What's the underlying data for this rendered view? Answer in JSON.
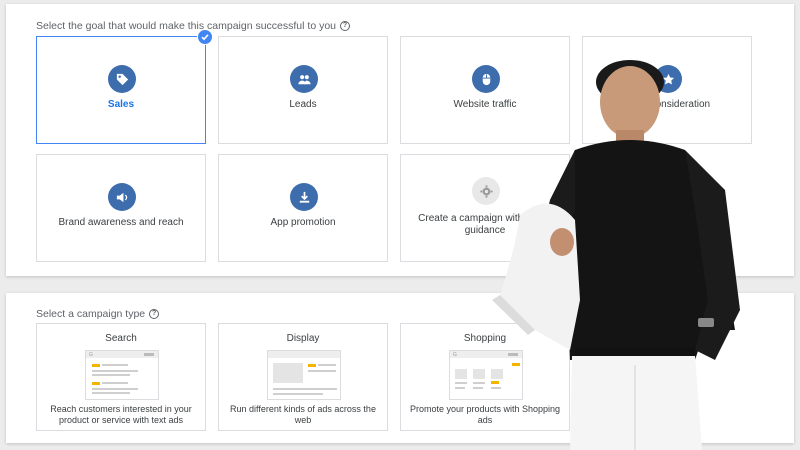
{
  "goal_section": {
    "heading": "Select the goal that would make this campaign successful to you",
    "help": "?",
    "goals": [
      {
        "label": "Sales",
        "icon": "tag-icon",
        "selected": true
      },
      {
        "label": "Leads",
        "icon": "people-icon",
        "selected": false
      },
      {
        "label": "Website traffic",
        "icon": "mouse-icon",
        "selected": false
      },
      {
        "label": "Product and brand consideration",
        "visible_label": "Pro                 d consideration",
        "icon": "star-icon",
        "selected": false
      },
      {
        "label": "Brand awareness and reach",
        "icon": "speaker-icon",
        "selected": false
      },
      {
        "label": "App promotion",
        "icon": "download-icon",
        "selected": false
      },
      {
        "label": "Create a campaign without a goal's guidance",
        "visible_label": "Create a campaign with goal's guidance",
        "icon": "gear-icon",
        "selected": false
      }
    ]
  },
  "type_section": {
    "heading": "Select a campaign type",
    "help": "?",
    "types": [
      {
        "title": "Search",
        "description": "Reach customers interested in your product or service with text ads"
      },
      {
        "title": "Display",
        "description": "Run different kinds of ads across the web"
      },
      {
        "title": "Shopping",
        "description": "Promote your products with Shopping ads"
      }
    ]
  },
  "colors": {
    "accent": "#4285f4",
    "icon_circle": "#3d6dad",
    "selected_text": "#1a73e8",
    "mock_highlight": "#f5b400"
  }
}
